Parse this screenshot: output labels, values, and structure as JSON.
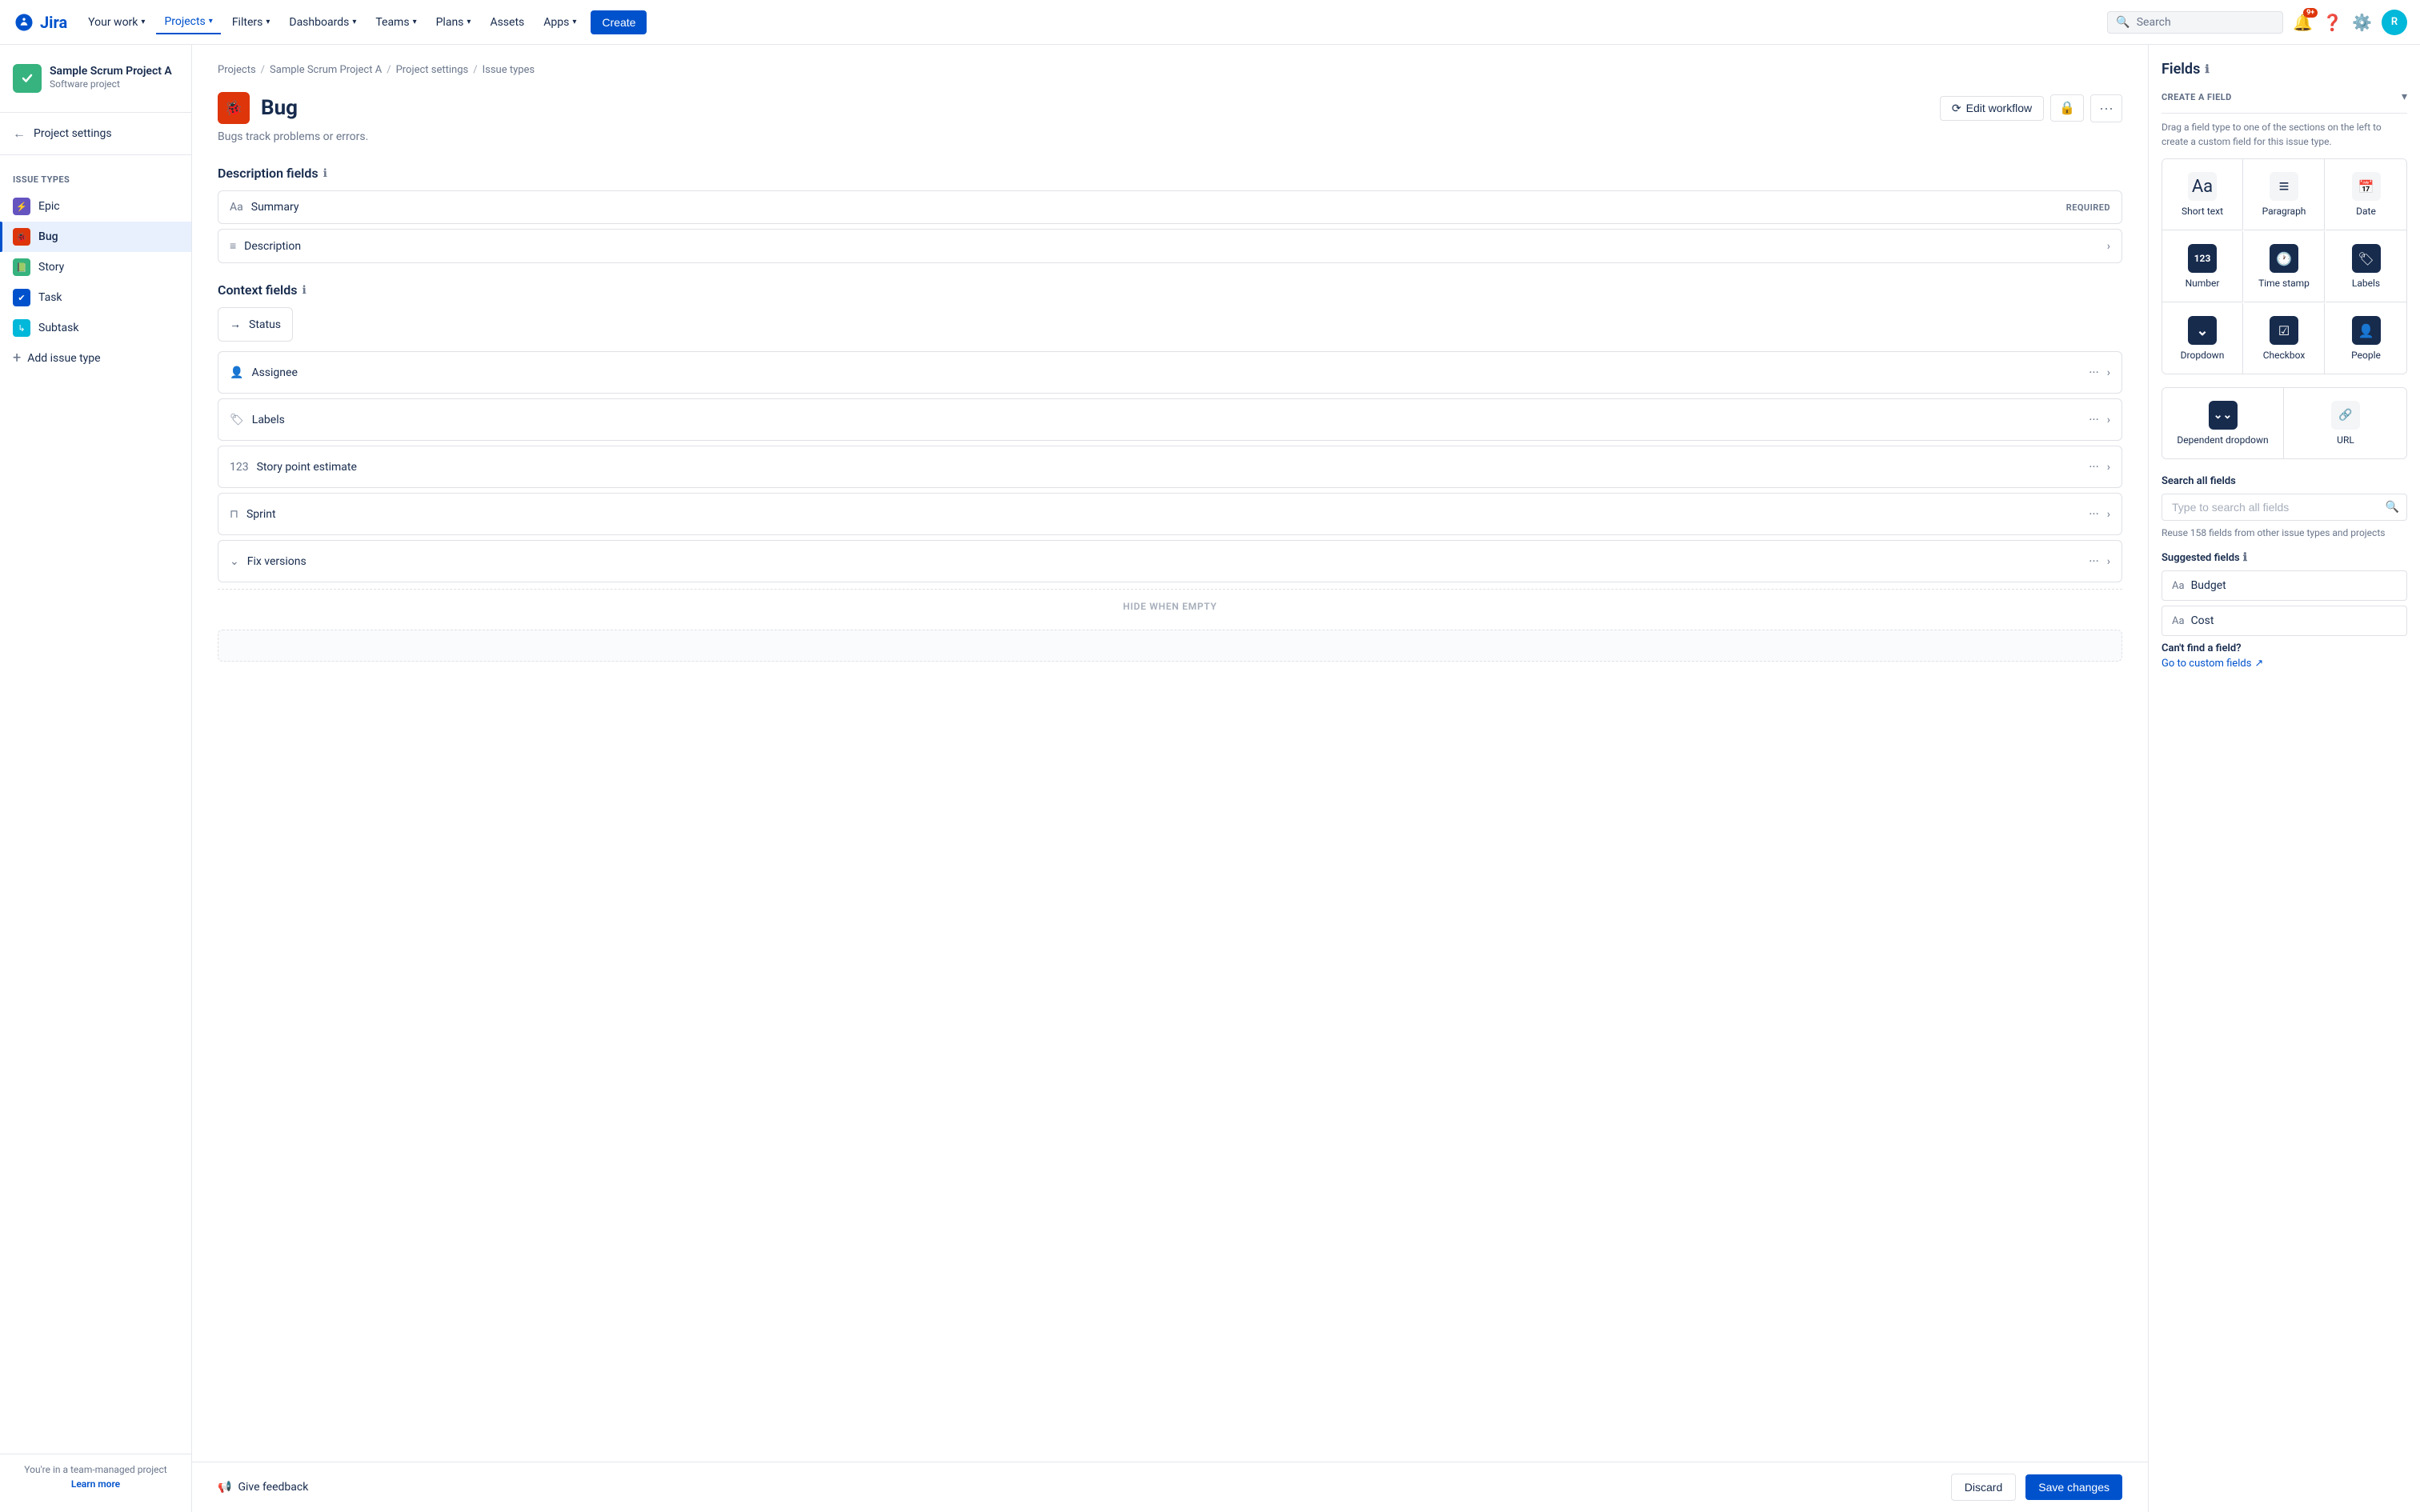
{
  "topnav": {
    "logo_text": "Jira",
    "your_work": "Your work",
    "projects": "Projects",
    "filters": "Filters",
    "dashboards": "Dashboards",
    "teams": "Teams",
    "plans": "Plans",
    "assets": "Assets",
    "apps": "Apps",
    "create": "Create",
    "search_placeholder": "Search",
    "notif_count": "9+",
    "avatar_initials": "R"
  },
  "sidebar": {
    "project_name": "Sample Scrum Project A",
    "project_type": "Software project",
    "project_settings": "Project settings",
    "section_title": "Issue types",
    "issue_types": [
      {
        "id": "epic",
        "label": "Epic",
        "color": "purple"
      },
      {
        "id": "bug",
        "label": "Bug",
        "color": "red",
        "active": true
      },
      {
        "id": "story",
        "label": "Story",
        "color": "green"
      },
      {
        "id": "task",
        "label": "Task",
        "color": "blue"
      },
      {
        "id": "subtask",
        "label": "Subtask",
        "color": "cyan"
      }
    ],
    "add_issue_type": "Add issue type",
    "team_note": "You're in a team-managed project",
    "learn_more": "Learn more"
  },
  "breadcrumb": {
    "projects": "Projects",
    "project_name": "Sample Scrum Project A",
    "project_settings": "Project settings",
    "issue_types": "Issue types"
  },
  "main": {
    "page_title": "Bug",
    "page_desc": "Bugs track problems or errors.",
    "edit_workflow": "Edit workflow",
    "description_fields_title": "Description fields",
    "context_fields_title": "Context fields",
    "fields": {
      "summary": {
        "label": "Summary",
        "required": "REQUIRED"
      },
      "description": {
        "label": "Description"
      },
      "status": {
        "label": "Status"
      },
      "assignee": {
        "label": "Assignee"
      },
      "labels": {
        "label": "Labels"
      },
      "story_point": {
        "label": "Story point estimate"
      },
      "sprint": {
        "label": "Sprint"
      },
      "fix_versions": {
        "label": "Fix versions"
      }
    },
    "hide_when_empty": "HIDE WHEN EMPTY"
  },
  "bottom_bar": {
    "feedback": "Give feedback",
    "discard": "Discard",
    "save": "Save changes"
  },
  "right_panel": {
    "title": "Fields",
    "create_field_label": "CREATE A FIELD",
    "create_field_desc": "Drag a field type to one of the sections on the left to create a custom field for this issue type.",
    "field_types": [
      {
        "id": "short-text",
        "label": "Short text",
        "icon": "Aa"
      },
      {
        "id": "paragraph",
        "label": "Paragraph",
        "icon": "≡"
      },
      {
        "id": "date",
        "label": "Date",
        "icon": "📅"
      },
      {
        "id": "number",
        "label": "Number",
        "icon": "123"
      },
      {
        "id": "time-stamp",
        "label": "Time stamp",
        "icon": "🕐"
      },
      {
        "id": "labels",
        "label": "Labels",
        "icon": "🏷"
      },
      {
        "id": "dropdown",
        "label": "Dropdown",
        "icon": "⌄"
      },
      {
        "id": "checkbox",
        "label": "Checkbox",
        "icon": "☑"
      },
      {
        "id": "people",
        "label": "People",
        "icon": "👤"
      }
    ],
    "last_row_types": [
      {
        "id": "dependent-dropdown",
        "label": "Dependent dropdown",
        "icon": "⌄⌄"
      },
      {
        "id": "url",
        "label": "URL",
        "icon": "🔗"
      }
    ],
    "search_label": "Search all fields",
    "search_placeholder": "Type to search all fields",
    "reuse_text": "Reuse 158 fields from other issue types and projects",
    "suggested_label": "Suggested fields",
    "suggested_fields": [
      {
        "id": "budget",
        "label": "Budget"
      },
      {
        "id": "cost",
        "label": "Cost"
      }
    ],
    "cant_find": "Can't find a field?",
    "go_custom": "Go to custom fields"
  }
}
